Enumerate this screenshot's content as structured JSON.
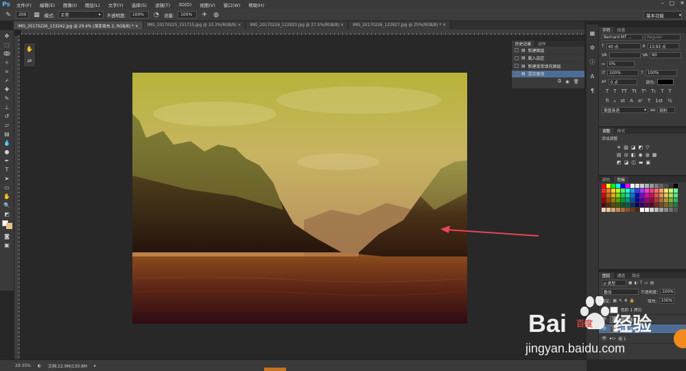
{
  "app": {
    "logo": "Ps"
  },
  "menu": [
    "文件(F)",
    "编辑(E)",
    "图像(I)",
    "图层(L)",
    "文字(Y)",
    "选择(S)",
    "滤镜(T)",
    "3D(D)",
    "视图(V)",
    "窗口(W)",
    "帮助(H)"
  ],
  "window_controls": [
    "–",
    "□",
    "✕"
  ],
  "options": {
    "brush_size": "200",
    "mode_label": "模式:",
    "mode_value": "正常",
    "opacity_label": "不透明度:",
    "opacity_value": "100%",
    "flow_label": "流量:",
    "flow_value": "100%",
    "workspace": "基本功能"
  },
  "tabs": [
    "IMG_20170226_133242.jpg @ 29.4% (渐变填充 2, RGB/8) * ×",
    "IMG_20170225_151715.jpg @ 33.3%(RGB/8) ×",
    "IMG_20170226_122820.jpg @ 27.5%(RGB/8) ×",
    "IMG_20170226_122827.jpg @ 25%(RGB/8) * ×"
  ],
  "history": {
    "tabs": [
      "历史记录",
      "动作"
    ],
    "items": [
      "新建图层",
      "载入选区",
      "新建渐变填充图层",
      "混合更改"
    ],
    "active_index": 3
  },
  "character": {
    "tabs": [
      "字符",
      "段落"
    ],
    "font_family": "Bernard MT ...",
    "font_style": "Regular",
    "font_size": "40 点",
    "leading": "13.93 点",
    "tracking": "60",
    "scale_percent": "0%",
    "vscale": "100%",
    "hscale": "100%",
    "baseline": "0 点",
    "color_label": "颜色:",
    "language": "美国英语",
    "aa_prefix": "aa",
    "antialias": "锐利"
  },
  "adjustments": {
    "tabs": [
      "调整",
      "样式"
    ],
    "title": "添加调整"
  },
  "swatches": {
    "tabs": [
      "颜色",
      "色板"
    ],
    "colors": [
      "#ff0000",
      "#ffff00",
      "#00ff00",
      "#00ffff",
      "#0000ff",
      "#ff00ff",
      "#ffffff",
      "#e6e6e6",
      "#cccccc",
      "#b3b3b3",
      "#999999",
      "#808080",
      "#666666",
      "#4d4d4d",
      "#333333",
      "#000000",
      "#ff2b2b",
      "#ff7a1f",
      "#ffd21f",
      "#b8ff1f",
      "#3dff6e",
      "#1fffd8",
      "#1f9cff",
      "#3a3aff",
      "#a13aff",
      "#ff3ad8",
      "#ff3a7d",
      "#ff6b6b",
      "#ffa36b",
      "#ffe36b",
      "#c9ff6b",
      "#6bff9b",
      "#d90000",
      "#d96200",
      "#d9b300",
      "#8cd900",
      "#00d94a",
      "#00d9b0",
      "#0076d9",
      "#0000d9",
      "#7a00d9",
      "#d900b0",
      "#d9005a",
      "#e64d4d",
      "#e68a4d",
      "#e6c24d",
      "#a6e64d",
      "#4de680",
      "#990000",
      "#994500",
      "#997d00",
      "#629900",
      "#009934",
      "#00997c",
      "#005299",
      "#000099",
      "#560099",
      "#99007c",
      "#99003f",
      "#b33939",
      "#b36b39",
      "#b39639",
      "#81b339",
      "#39b363",
      "#5c0000",
      "#5c2a00",
      "#5c4b00",
      "#3b5c00",
      "#005c1f",
      "#005c4a",
      "#00315c",
      "#00005c",
      "#33005c",
      "#5c004a",
      "#5c0026",
      "#7a2626",
      "#7a4826",
      "#7a6626",
      "#587a26",
      "#267a44",
      "#f2d4b6",
      "#e8c49a",
      "#d9a877",
      "#c48a55",
      "#a86b3a",
      "#8a5028",
      "#6b3a1b",
      "#4d2812",
      "#ffffff",
      "#f0f0f0",
      "#d6d6d6",
      "#bdbdbd",
      "#a3a3a3",
      "#8a8a8a",
      "#707070",
      "#575757"
    ]
  },
  "layers": {
    "tabs": [
      "图层",
      "通道",
      "路径"
    ],
    "kind_label": "ρ 类型",
    "blend_mode": "叠加",
    "opacity_label": "不透明度:",
    "opacity_value": "100%",
    "lock_label": "锁定:",
    "fill_label": "填充:",
    "fill_value": "100%",
    "rows": [
      "色阶 1 拷贝",
      "渐变填充 2",
      "渐变填充 2",
      "组 1"
    ]
  },
  "status": {
    "zoom": "29.35%",
    "doc": "文档:22.9M/130.8M"
  },
  "watermark": {
    "brand": "Bai",
    "brand2": "百度",
    "subtitle": "经验",
    "url": "jingyan.baidu.com"
  }
}
